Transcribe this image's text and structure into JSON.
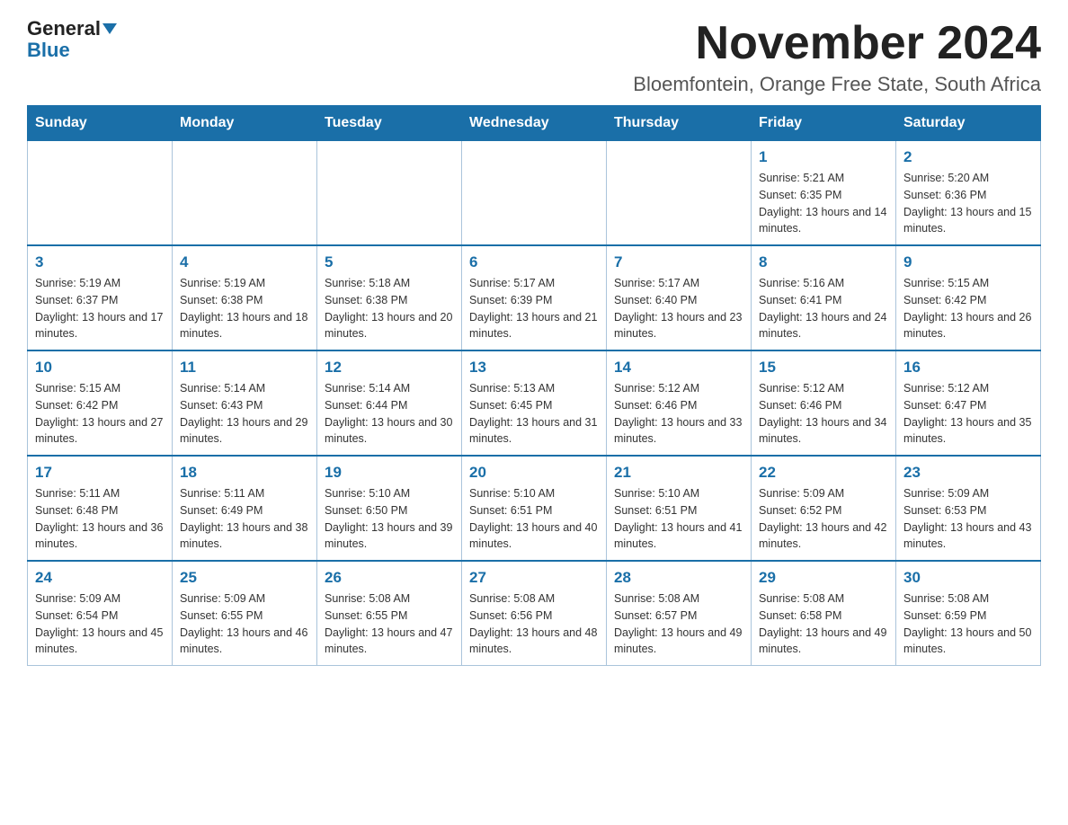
{
  "header": {
    "logo_general": "General",
    "logo_blue": "Blue",
    "month_title": "November 2024",
    "location": "Bloemfontein, Orange Free State, South Africa"
  },
  "days_of_week": [
    "Sunday",
    "Monday",
    "Tuesday",
    "Wednesday",
    "Thursday",
    "Friday",
    "Saturday"
  ],
  "weeks": [
    [
      {
        "day": "",
        "info": ""
      },
      {
        "day": "",
        "info": ""
      },
      {
        "day": "",
        "info": ""
      },
      {
        "day": "",
        "info": ""
      },
      {
        "day": "",
        "info": ""
      },
      {
        "day": "1",
        "info": "Sunrise: 5:21 AM\nSunset: 6:35 PM\nDaylight: 13 hours and 14 minutes."
      },
      {
        "day": "2",
        "info": "Sunrise: 5:20 AM\nSunset: 6:36 PM\nDaylight: 13 hours and 15 minutes."
      }
    ],
    [
      {
        "day": "3",
        "info": "Sunrise: 5:19 AM\nSunset: 6:37 PM\nDaylight: 13 hours and 17 minutes."
      },
      {
        "day": "4",
        "info": "Sunrise: 5:19 AM\nSunset: 6:38 PM\nDaylight: 13 hours and 18 minutes."
      },
      {
        "day": "5",
        "info": "Sunrise: 5:18 AM\nSunset: 6:38 PM\nDaylight: 13 hours and 20 minutes."
      },
      {
        "day": "6",
        "info": "Sunrise: 5:17 AM\nSunset: 6:39 PM\nDaylight: 13 hours and 21 minutes."
      },
      {
        "day": "7",
        "info": "Sunrise: 5:17 AM\nSunset: 6:40 PM\nDaylight: 13 hours and 23 minutes."
      },
      {
        "day": "8",
        "info": "Sunrise: 5:16 AM\nSunset: 6:41 PM\nDaylight: 13 hours and 24 minutes."
      },
      {
        "day": "9",
        "info": "Sunrise: 5:15 AM\nSunset: 6:42 PM\nDaylight: 13 hours and 26 minutes."
      }
    ],
    [
      {
        "day": "10",
        "info": "Sunrise: 5:15 AM\nSunset: 6:42 PM\nDaylight: 13 hours and 27 minutes."
      },
      {
        "day": "11",
        "info": "Sunrise: 5:14 AM\nSunset: 6:43 PM\nDaylight: 13 hours and 29 minutes."
      },
      {
        "day": "12",
        "info": "Sunrise: 5:14 AM\nSunset: 6:44 PM\nDaylight: 13 hours and 30 minutes."
      },
      {
        "day": "13",
        "info": "Sunrise: 5:13 AM\nSunset: 6:45 PM\nDaylight: 13 hours and 31 minutes."
      },
      {
        "day": "14",
        "info": "Sunrise: 5:12 AM\nSunset: 6:46 PM\nDaylight: 13 hours and 33 minutes."
      },
      {
        "day": "15",
        "info": "Sunrise: 5:12 AM\nSunset: 6:46 PM\nDaylight: 13 hours and 34 minutes."
      },
      {
        "day": "16",
        "info": "Sunrise: 5:12 AM\nSunset: 6:47 PM\nDaylight: 13 hours and 35 minutes."
      }
    ],
    [
      {
        "day": "17",
        "info": "Sunrise: 5:11 AM\nSunset: 6:48 PM\nDaylight: 13 hours and 36 minutes."
      },
      {
        "day": "18",
        "info": "Sunrise: 5:11 AM\nSunset: 6:49 PM\nDaylight: 13 hours and 38 minutes."
      },
      {
        "day": "19",
        "info": "Sunrise: 5:10 AM\nSunset: 6:50 PM\nDaylight: 13 hours and 39 minutes."
      },
      {
        "day": "20",
        "info": "Sunrise: 5:10 AM\nSunset: 6:51 PM\nDaylight: 13 hours and 40 minutes."
      },
      {
        "day": "21",
        "info": "Sunrise: 5:10 AM\nSunset: 6:51 PM\nDaylight: 13 hours and 41 minutes."
      },
      {
        "day": "22",
        "info": "Sunrise: 5:09 AM\nSunset: 6:52 PM\nDaylight: 13 hours and 42 minutes."
      },
      {
        "day": "23",
        "info": "Sunrise: 5:09 AM\nSunset: 6:53 PM\nDaylight: 13 hours and 43 minutes."
      }
    ],
    [
      {
        "day": "24",
        "info": "Sunrise: 5:09 AM\nSunset: 6:54 PM\nDaylight: 13 hours and 45 minutes."
      },
      {
        "day": "25",
        "info": "Sunrise: 5:09 AM\nSunset: 6:55 PM\nDaylight: 13 hours and 46 minutes."
      },
      {
        "day": "26",
        "info": "Sunrise: 5:08 AM\nSunset: 6:55 PM\nDaylight: 13 hours and 47 minutes."
      },
      {
        "day": "27",
        "info": "Sunrise: 5:08 AM\nSunset: 6:56 PM\nDaylight: 13 hours and 48 minutes."
      },
      {
        "day": "28",
        "info": "Sunrise: 5:08 AM\nSunset: 6:57 PM\nDaylight: 13 hours and 49 minutes."
      },
      {
        "day": "29",
        "info": "Sunrise: 5:08 AM\nSunset: 6:58 PM\nDaylight: 13 hours and 49 minutes."
      },
      {
        "day": "30",
        "info": "Sunrise: 5:08 AM\nSunset: 6:59 PM\nDaylight: 13 hours and 50 minutes."
      }
    ]
  ]
}
